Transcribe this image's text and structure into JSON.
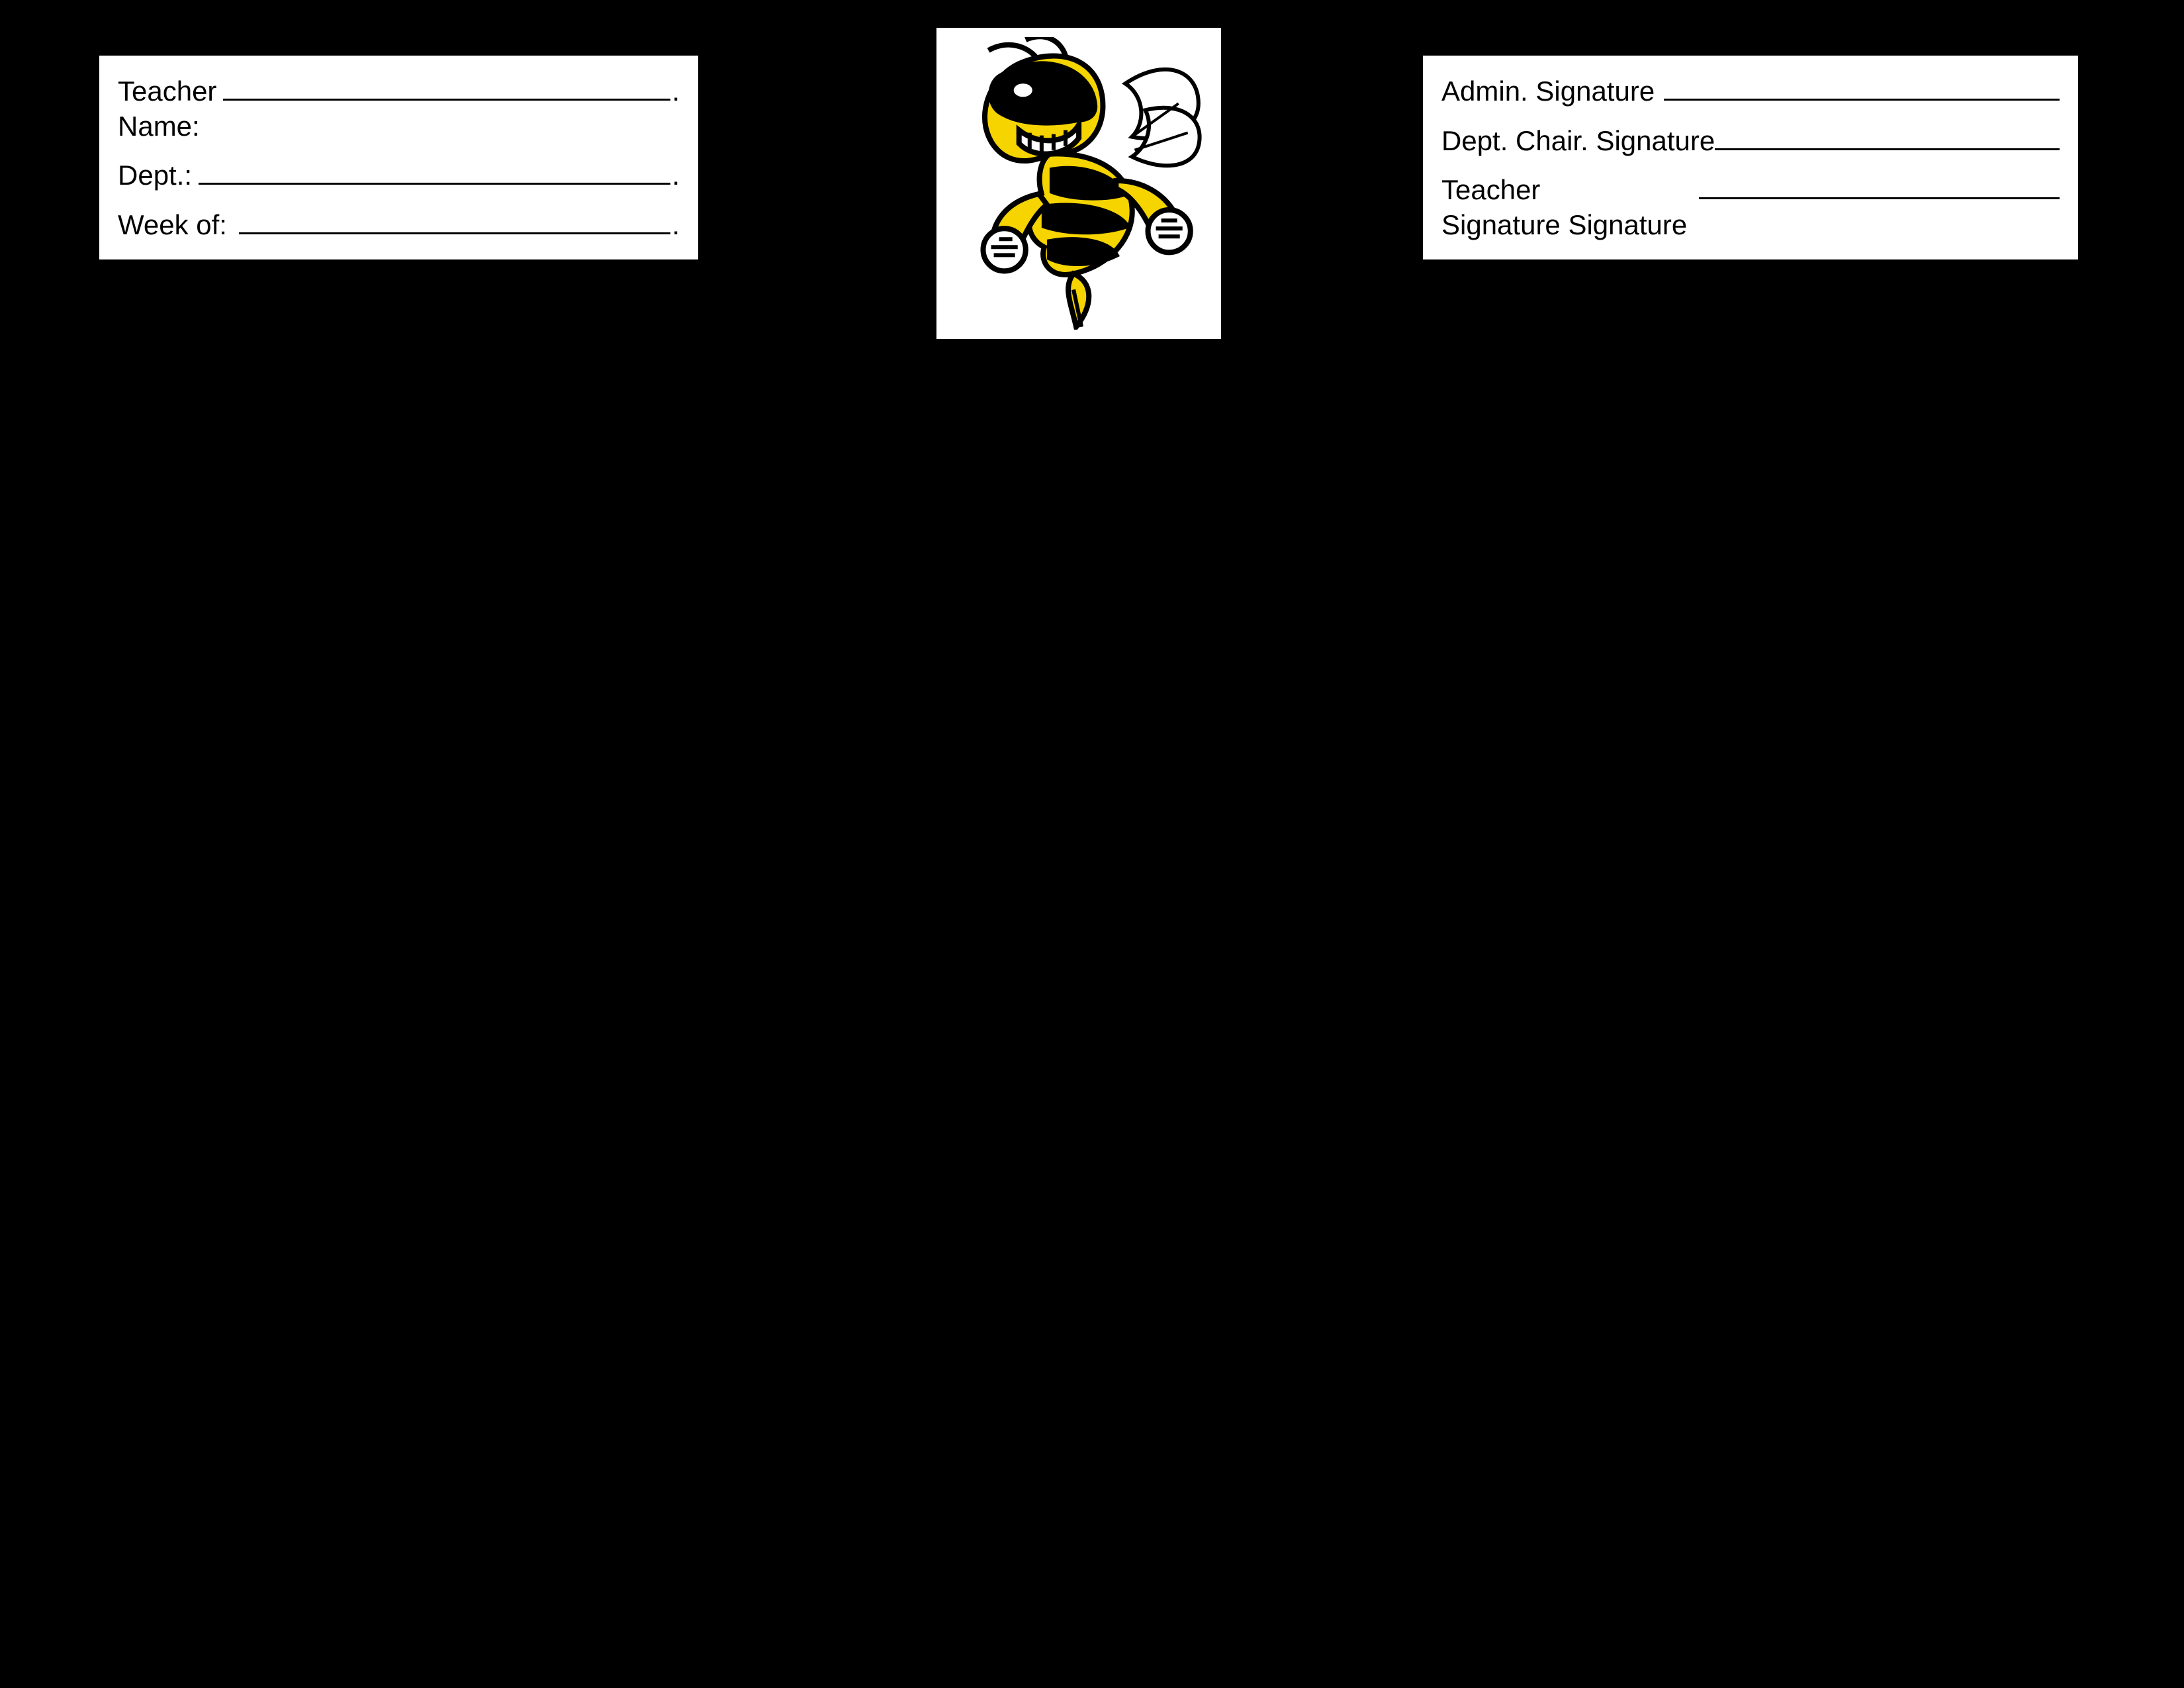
{
  "left_card": {
    "teacher_name_label": "Teacher\nName:",
    "teacher_name_value": "",
    "dept_label": "Dept.:",
    "dept_value": "",
    "week_of_label": "Week of:",
    "week_of_value": "",
    "trailing_dot": "."
  },
  "right_card": {
    "admin_sig_label": "Admin. Signature",
    "admin_sig_value": "",
    "dept_chair_sig_label": "Dept. Chair. Signature",
    "dept_chair_sig_value": "",
    "teacher_sig_label": "Teacher\nSignature Signature",
    "teacher_sig_value": ""
  },
  "logo": {
    "name": "hornet-mascot"
  }
}
